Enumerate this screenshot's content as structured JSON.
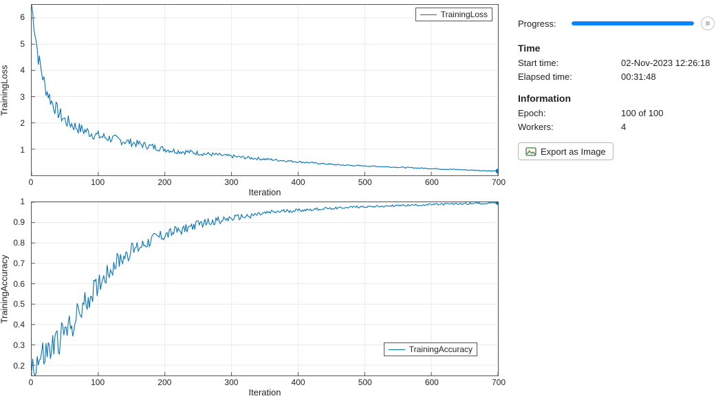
{
  "side": {
    "progress": {
      "label": "Progress:",
      "percent": 100
    },
    "time": {
      "header": "Time",
      "start_label": "Start time:",
      "start_value": "02-Nov-2023 12:26:18",
      "elapsed_label": "Elapsed time:",
      "elapsed_value": "00:31:48"
    },
    "info": {
      "header": "Information",
      "epoch_label": "Epoch:",
      "epoch_value": "100 of 100",
      "workers_label": "Workers:",
      "workers_value": "4"
    },
    "export_label": "Export as Image"
  },
  "chart_data": [
    {
      "type": "line",
      "title": "",
      "xlabel": "Iteration",
      "ylabel": "TrainingLoss",
      "xlim": [
        0,
        700
      ],
      "ylim": [
        0,
        6.5
      ],
      "xticks": [
        0,
        100,
        200,
        300,
        400,
        500,
        600,
        700
      ],
      "yticks": [
        1,
        2,
        3,
        4,
        5,
        6
      ],
      "legend": {
        "label": "TrainingLoss",
        "position": "top-right"
      },
      "series": [
        {
          "name": "TrainingLoss",
          "x_step": 10,
          "x_range": [
            0,
            700
          ],
          "values": [
            6.5,
            4.5,
            3.4,
            2.8,
            2.4,
            2.1,
            1.95,
            1.8,
            1.7,
            1.6,
            1.5,
            1.45,
            1.4,
            1.35,
            1.3,
            1.25,
            1.2,
            1.15,
            1.1,
            1.05,
            1.0,
            0.95,
            0.92,
            0.9,
            0.88,
            0.85,
            0.82,
            0.8,
            0.78,
            0.75,
            0.73,
            0.7,
            0.68,
            0.66,
            0.64,
            0.62,
            0.6,
            0.58,
            0.56,
            0.54,
            0.52,
            0.5,
            0.48,
            0.46,
            0.44,
            0.42,
            0.4,
            0.39,
            0.38,
            0.37,
            0.36,
            0.35,
            0.34,
            0.33,
            0.32,
            0.31,
            0.3,
            0.29,
            0.28,
            0.27,
            0.26,
            0.25,
            0.24,
            0.23,
            0.22,
            0.21,
            0.2,
            0.19,
            0.18,
            0.17,
            0.16
          ]
        }
      ]
    },
    {
      "type": "line",
      "title": "",
      "xlabel": "Iteration",
      "ylabel": "TrainingAccuracy",
      "xlim": [
        0,
        700
      ],
      "ylim": [
        0.15,
        1.0
      ],
      "xticks": [
        0,
        100,
        200,
        300,
        400,
        500,
        600,
        700
      ],
      "yticks": [
        0.2,
        0.3,
        0.4,
        0.5,
        0.6,
        0.7,
        0.8,
        0.9,
        1.0
      ],
      "legend": {
        "label": "TrainingAccuracy",
        "position": "bottom-right"
      },
      "series": [
        {
          "name": "TrainingAccuracy",
          "x_step": 10,
          "x_range": [
            0,
            700
          ],
          "values": [
            0.2,
            0.22,
            0.25,
            0.28,
            0.32,
            0.36,
            0.4,
            0.45,
            0.5,
            0.55,
            0.6,
            0.64,
            0.68,
            0.71,
            0.74,
            0.76,
            0.78,
            0.8,
            0.82,
            0.83,
            0.84,
            0.85,
            0.86,
            0.87,
            0.88,
            0.89,
            0.9,
            0.905,
            0.91,
            0.915,
            0.92,
            0.925,
            0.93,
            0.935,
            0.94,
            0.945,
            0.95,
            0.953,
            0.956,
            0.958,
            0.96,
            0.962,
            0.964,
            0.966,
            0.968,
            0.97,
            0.972,
            0.974,
            0.976,
            0.977,
            0.978,
            0.979,
            0.98,
            0.981,
            0.982,
            0.983,
            0.984,
            0.985,
            0.986,
            0.987,
            0.988,
            0.989,
            0.99,
            0.991,
            0.992,
            0.993,
            0.994,
            0.995,
            0.996,
            0.997,
            0.998
          ]
        }
      ]
    }
  ]
}
